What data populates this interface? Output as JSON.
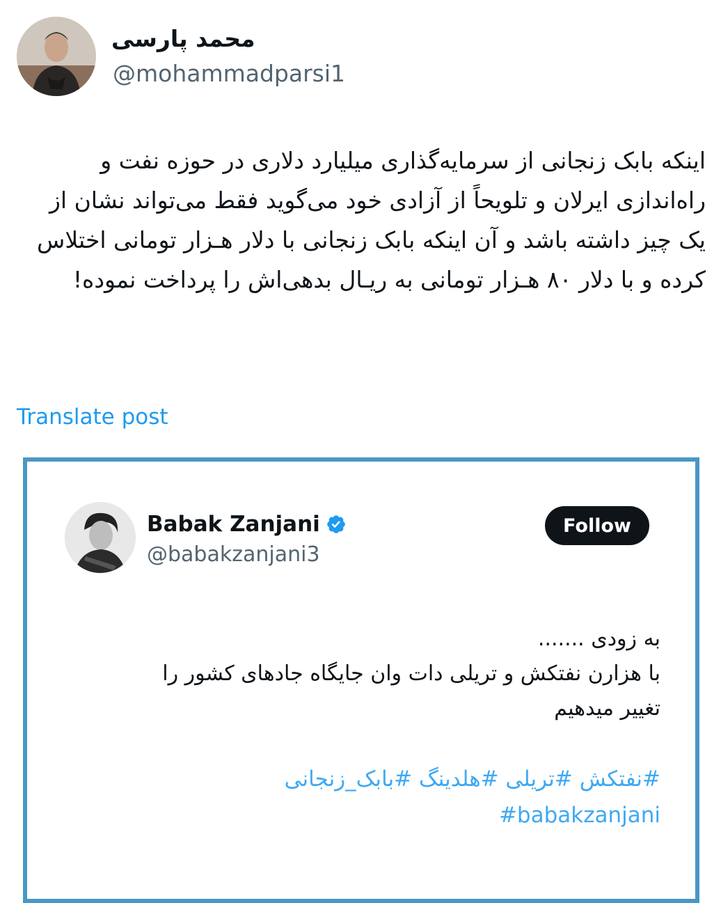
{
  "author": {
    "display_name": "محمد پارسی",
    "handle": "@mohammadparsi1"
  },
  "post": {
    "text": "اینکه بابک زنجانی از سرمایه‌گذاری میلیارد دلاری در حوزه نفت و راه‌اندازی ایرلان و تلویحاً از آزادی خود می‌گوید فقط می‌تواند نشان از یک چیز داشته باشد و آن اینکه بابک زنجانی با دلار هـزار تومانی اختلاس کرده و با دلار ۸۰ هـزار تومانی به ریـال بدهی‌اش را پرداخت نموده!",
    "translate_label": "Translate post"
  },
  "quoted_post": {
    "display_name": "Babak Zanjani",
    "handle": "@babakzanjani3",
    "follow_label": "Follow",
    "verified": true,
    "lines": [
      "به زودی .......",
      "با هزارن نفتکش و تریلی دات وان جایگاه جادهای کشور را",
      "تغییر میدهیم"
    ],
    "hashtags_line1": [
      "#نفتکش",
      "#تریلی",
      "#هلدینگ",
      "#بابک_زنجانی"
    ],
    "hashtags_line2": [
      "#babakzanjani"
    ]
  },
  "colors": {
    "link": "#1d9bf0",
    "frame": "#4a97c3",
    "button_bg": "#0f1419"
  },
  "icons": {
    "verified": "verified-badge-icon"
  }
}
